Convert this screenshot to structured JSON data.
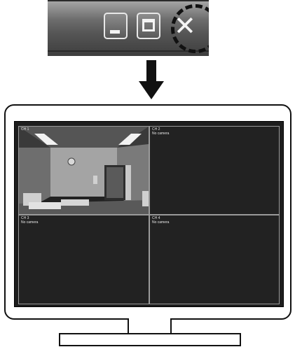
{
  "window_controls": {
    "minimize_icon": "minimize-icon",
    "maximize_icon": "maximize-icon",
    "close_icon": "close-icon",
    "close_glyph": "✕",
    "highlighted": "maximize",
    "ring_color": "#111111"
  },
  "arrow": {
    "direction": "down",
    "color": "#111111"
  },
  "monitor": {
    "channels": [
      {
        "name": "CH 1",
        "status": ""
      },
      {
        "name": "CH 2",
        "status": "No camera"
      },
      {
        "name": "CH 3",
        "status": "No camera"
      },
      {
        "name": "CH 4",
        "status": "No camera"
      }
    ]
  }
}
